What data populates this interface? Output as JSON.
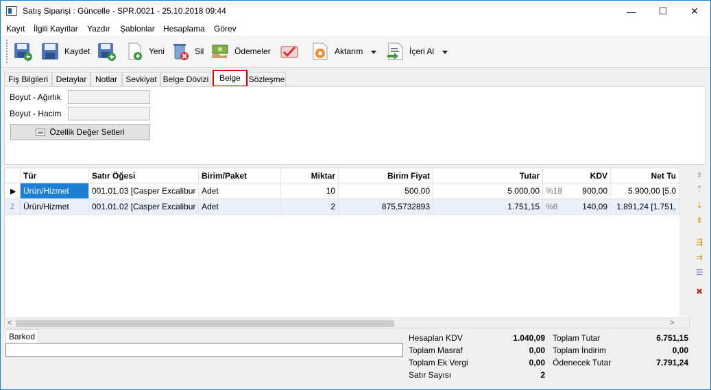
{
  "window": {
    "title": "Satış Siparişi : Güncelle - SPR.0021 - 25.10.2018 09:44",
    "minimize": "—",
    "maximize": "☐",
    "close": "✕"
  },
  "menu": [
    "Kayıt",
    "İlgili Kayıtlar",
    "Yazdır",
    "Şablonlar",
    "Hesaplama",
    "Görev"
  ],
  "toolbar": {
    "save_label": "Kaydet",
    "new_label": "Yeni",
    "delete_label": "Sil",
    "payments_label": "Ödemeler",
    "transfer_label": "Aktarım",
    "import_label": "İçeri Al"
  },
  "tabs": [
    "Fiş Bilgileri",
    "Detaylar",
    "Notlar",
    "Sevkiyat",
    "Belge Dövizi",
    "Belge",
    "Sözleşme"
  ],
  "belge": {
    "weight_label": "Boyut - Ağırlık",
    "weight_value": "",
    "volume_label": "Boyut - Hacim",
    "volume_value": "",
    "props_button": "Özellik Değer Setleri"
  },
  "grid": {
    "columns": [
      "Tür",
      "Satır Öğesi",
      "Birim/Paket",
      "Miktar",
      "Birim Fiyat",
      "Tutar",
      "KDV",
      "Net Tu"
    ],
    "rows": [
      {
        "indicator": "▶",
        "type": "Ürün/Hizmet",
        "item": "001.01.03 [Casper Excalibur ...",
        "unit": "Adet",
        "qty": "10",
        "price": "500,00",
        "amount": "5.000,00",
        "vat_rate": "%18",
        "vat": "900,00",
        "net": "5.900,00 [5.0"
      },
      {
        "indicator": "2",
        "type": "Ürün/Hizmet",
        "item": "001.01.02 [Casper Excalibur ...",
        "unit": "Adet",
        "qty": "2",
        "price": "875,5732893",
        "amount": "1.751,15",
        "vat_rate": "%8",
        "vat": "140,09",
        "net": "1.891,24 [1.751,"
      }
    ]
  },
  "barcode": {
    "tab_label": "Barkod",
    "value": ""
  },
  "totals": {
    "calc_vat_label": "Hesaplan KDV",
    "calc_vat": "1.040,09",
    "total_expense_label": "Toplam Masraf",
    "total_expense": "0,00",
    "total_extra_tax_label": "Toplam Ek Vergi",
    "total_extra_tax": "0,00",
    "row_count_label": "Satır Sayısı",
    "row_count": "2",
    "total_amount_label": "Toplam Tutar",
    "total_amount": "6.751,15",
    "total_discount_label": "Toplam İndirim",
    "total_discount": "0,00",
    "payable_label": "Ödenecek Tutar",
    "payable": "7.791,24"
  },
  "colors": {
    "selected_cell": "#1e7fd0",
    "active_tab_border": "#e00000",
    "alt_row": "#eaf0fb"
  }
}
